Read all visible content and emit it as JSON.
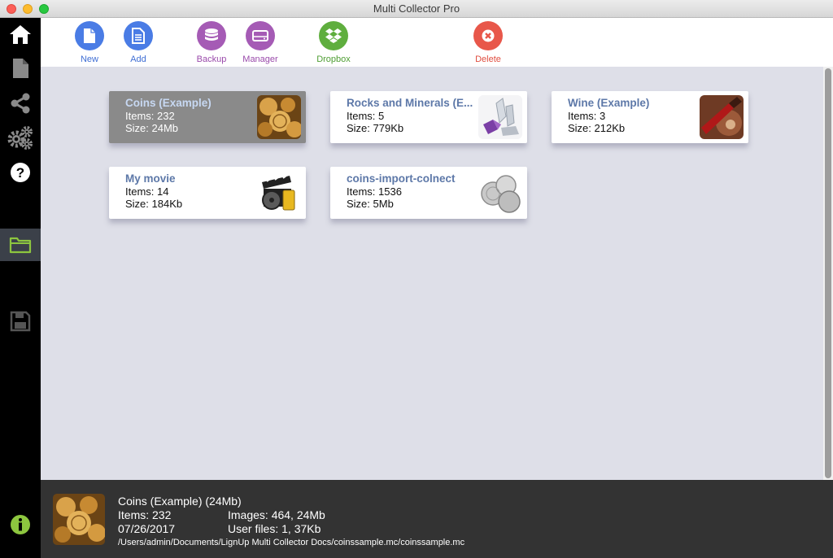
{
  "window": {
    "title": "Multi Collector Pro"
  },
  "sidebar": {
    "items": [
      {
        "name": "home",
        "icon": "home-icon"
      },
      {
        "name": "document",
        "icon": "document-icon"
      },
      {
        "name": "share",
        "icon": "share-icon"
      },
      {
        "name": "settings",
        "icon": "gears-icon"
      },
      {
        "name": "help",
        "icon": "help-icon"
      },
      {
        "name": "folder",
        "icon": "folder-icon",
        "active": true
      },
      {
        "name": "save",
        "icon": "save-icon"
      },
      {
        "name": "info",
        "icon": "info-icon"
      }
    ],
    "active_color": "#8dc63f"
  },
  "toolbar": {
    "new": {
      "label": "New",
      "color": "#4a7ce5",
      "icon": "new-file-icon"
    },
    "add": {
      "label": "Add",
      "color": "#4a7ce5",
      "icon": "add-document-icon"
    },
    "backup": {
      "label": "Backup",
      "color": "#a55bb5",
      "icon": "database-icon"
    },
    "manager": {
      "label": "Manager",
      "color": "#a55bb5",
      "icon": "drive-icon"
    },
    "dropbox": {
      "label": "Dropbox",
      "color": "#5fae3e",
      "icon": "dropbox-icon"
    },
    "delete": {
      "label": "Delete",
      "color": "#e8574a",
      "icon": "delete-icon"
    }
  },
  "collections": [
    {
      "name": "Coins (Example)",
      "items": "Items: 232",
      "size": "Size: 24Mb",
      "selected": true,
      "thumb": "coins"
    },
    {
      "name": "Rocks and Minerals (E...",
      "items": "Items: 5",
      "size": "Size: 779Kb",
      "selected": false,
      "thumb": "minerals"
    },
    {
      "name": "Wine (Example)",
      "items": "Items: 3",
      "size": "Size: 212Kb",
      "selected": false,
      "thumb": "wine"
    },
    {
      "name": "My movie",
      "items": "Items: 14",
      "size": "Size: 184Kb",
      "selected": false,
      "thumb": "movie"
    },
    {
      "name": "coins-import-colnect",
      "items": "Items: 1536",
      "size": "Size: 5Mb",
      "selected": false,
      "thumb": "silver-coins"
    }
  ],
  "info": {
    "title": "Coins (Example) (24Mb)",
    "items": "Items: 232",
    "images": "Images: 464,  24Mb",
    "date": "07/26/2017",
    "user_files": "User files: 1,  37Kb",
    "path": "/Users/admin/Documents/LignUp Multi Collector Docs/coinssample.mc/coinssample.mc"
  }
}
